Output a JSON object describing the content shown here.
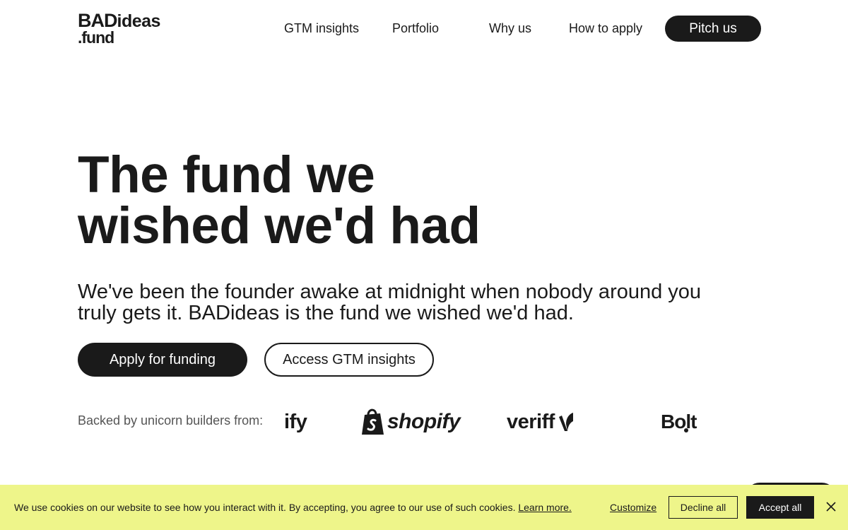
{
  "brand": {
    "logo_line1_bold": "BAD",
    "logo_line1_rest": "ideas",
    "logo_line2": ".fund"
  },
  "nav": {
    "items": [
      {
        "label": "GTM insights"
      },
      {
        "label": "Portfolio"
      },
      {
        "label": "Why us"
      },
      {
        "label": "How to apply"
      }
    ],
    "cta_label": "Pitch us"
  },
  "hero": {
    "title_line1": "The fund we",
    "title_line2": "wished we'd had",
    "subtitle": "We've been the founder awake at midnight when nobody around you truly gets it. BADideas is the fund we wished we'd had.",
    "primary_button": "Apply for funding",
    "secondary_button": "Access GTM insights"
  },
  "backed": {
    "label": "Backed by unicorn builders from:",
    "logos": [
      {
        "name": "ify"
      },
      {
        "name": "shopify",
        "icon": "shopify-bag-icon"
      },
      {
        "name": "veriff",
        "icon": "veriff-mark-icon"
      },
      {
        "name": "Bolt"
      }
    ]
  },
  "cookie": {
    "message": "We use cookies on our website to see how you interact with it. By accepting, you agree to our use of such cookies.",
    "learn_more": "Learn more.",
    "customize": "Customize",
    "decline": "Decline all",
    "accept": "Accept all",
    "close_icon": "close-icon",
    "background_color": "#eef58a"
  },
  "colors": {
    "text": "#1a1a1a",
    "primary_button_bg": "#1a1a1a",
    "page_bg": "#ffffff"
  }
}
